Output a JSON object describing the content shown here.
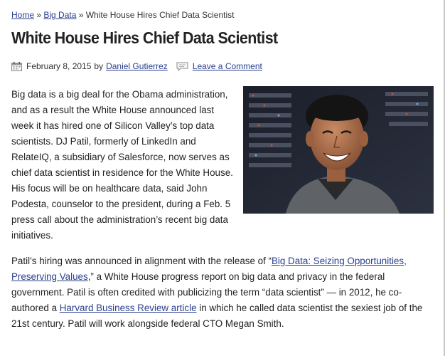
{
  "breadcrumb": {
    "home": "Home",
    "sep1": " » ",
    "category": "Big Data",
    "sep2": " » ",
    "current": "White House Hires Chief Data Scientist"
  },
  "article": {
    "title": "White House Hires Chief Data Scientist",
    "date": "February 8, 2015",
    "by": "by",
    "author": "Daniel Gutierrez",
    "comment_link": "Leave a Comment",
    "paragraph1": "Big data is a big deal for the Obama administration, and as a result the White House announced last week it has hired one of Silicon Valley’s top data scientists. DJ Patil, formerly of LinkedIn and RelateIQ, a subsidiary of Salesforce, now serves as chief data scientist in residence for the White House. His focus will be on healthcare data, said John Podesta, counselor to the president, during a Feb. 5 press call about the administration’s recent big data initiatives.",
    "p2_before_link": "Patil’s hiring was announced in alignment with the release of “",
    "p2_link1": "Big Data: Seizing Opportunities, Preserving Values",
    "p2_middle": ",” a White House progress report on big data and privacy in the federal government. Patil is often credited with publicizing the term “data scientist” — in 2012, he co-authored a ",
    "p2_link2": "Harvard Business Review article",
    "p2_after_link": " in which he called data scientist the sexiest job of the 21st century. Patil will work alongside federal CTO Megan Smith."
  },
  "colors": {
    "link": "#2a3f8f",
    "text": "#222222"
  },
  "icons": {
    "calendar": "calendar-icon",
    "comment": "comment-icon"
  }
}
